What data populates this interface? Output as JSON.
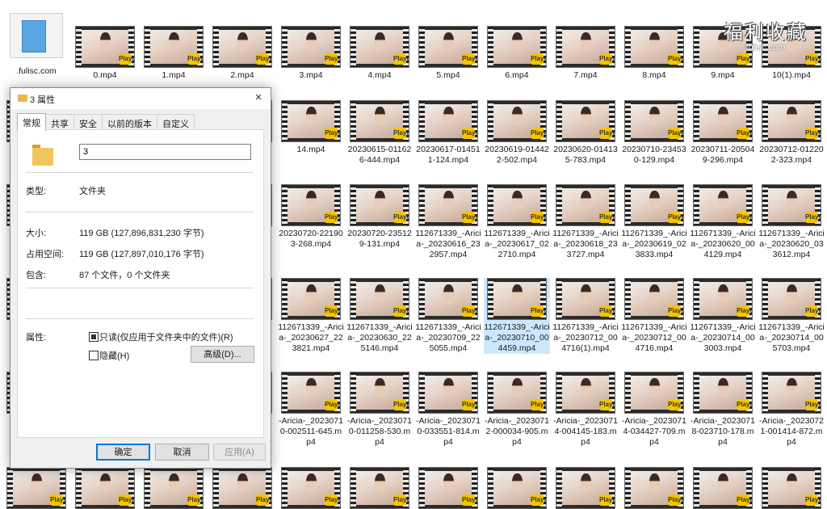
{
  "watermark": {
    "title": "福利收藏",
    "subtitle": "fulisc.com"
  },
  "grid_rows": [
    [
      "0.mp4",
      "1.mp4",
      "2.mp4",
      "3.mp4",
      "4.mp4",
      "5.mp4",
      "6.mp4",
      "7.mp4",
      "8.mp4",
      "9.mp4",
      "10(1).mp4"
    ],
    [
      "14.mp4",
      "20230615-011626-444.mp4",
      "20230617-014511-124.mp4",
      "20230619-014422-502.mp4",
      "20230620-014135-783.mp4",
      "20230710-234530-129.mp4",
      "20230711-205049-296.mp4",
      "20230712-012202-323.mp4"
    ],
    [
      "20230720-221903-268.mp4",
      "20230720-235129-131.mp4",
      "112671339_-Aricia-_20230616_232957.mp4",
      "112671339_-Aricia-_20230617_022710.mp4",
      "112671339_-Aricia-_20230618_233727.mp4",
      "112671339_-Aricia-_20230619_023833.mp4",
      "112671339_-Aricia-_20230620_004129.mp4",
      "112671339_-Aricia-_20230620_033612.mp4"
    ],
    [
      "112671339_-Aricia-_20230627_223821.mp4",
      "112671339_-Aricia-_20230630_225146.mp4",
      "112671339_-Aricia-_20230709_225055.mp4",
      "112671339_-Aricia-_20230710_004459.mp4",
      "112671339_-Aricia-_20230712_004716(1).mp4",
      "112671339_-Aricia-_20230712_004716.mp4",
      "112671339_-Aricia-_20230714_003003.mp4",
      "112671339_-Aricia-_20230714_005703.mp4"
    ],
    [
      "-Aricia-_20230710-002511-645.mp4",
      "-Aricia-_20230710-011258-530.mp4",
      "-Aricia-_20230710-033551-814.mp4",
      "-Aricia-_20230712-000034-905.mp4",
      "-Aricia-_20230714-004145-183.mp4",
      "-Aricia-_20230714-034427-709.mp4",
      "-Aricia-_20230718-023710-178.mp4",
      "-Aricia-_20230721-001414-872.mp4"
    ]
  ],
  "first_item": ".fulisc.com",
  "player_badge": "Player",
  "dialog": {
    "title": "3 属性",
    "close": "×",
    "tabs": [
      "常规",
      "共享",
      "安全",
      "以前的版本",
      "自定义"
    ],
    "folder_name": "3",
    "type_label": "类型:",
    "type_value": "文件夹",
    "size_label": "大小:",
    "size_value": "119 GB (127,896,831,230 字节)",
    "disk_size_label": "占用空间:",
    "disk_size_value": "119 GB (127,897,010,176 字节)",
    "contains_label": "包含:",
    "contains_value": "87 个文件，0 个文件夹",
    "attributes_label": "属性:",
    "readonly_label": "只读(仅应用于文件夹中的文件)(R)",
    "hidden_label": "隐藏(H)",
    "advanced_button": "高级(D)...",
    "ok_button": "确定",
    "cancel_button": "取消",
    "apply_button": "应用(A)"
  }
}
